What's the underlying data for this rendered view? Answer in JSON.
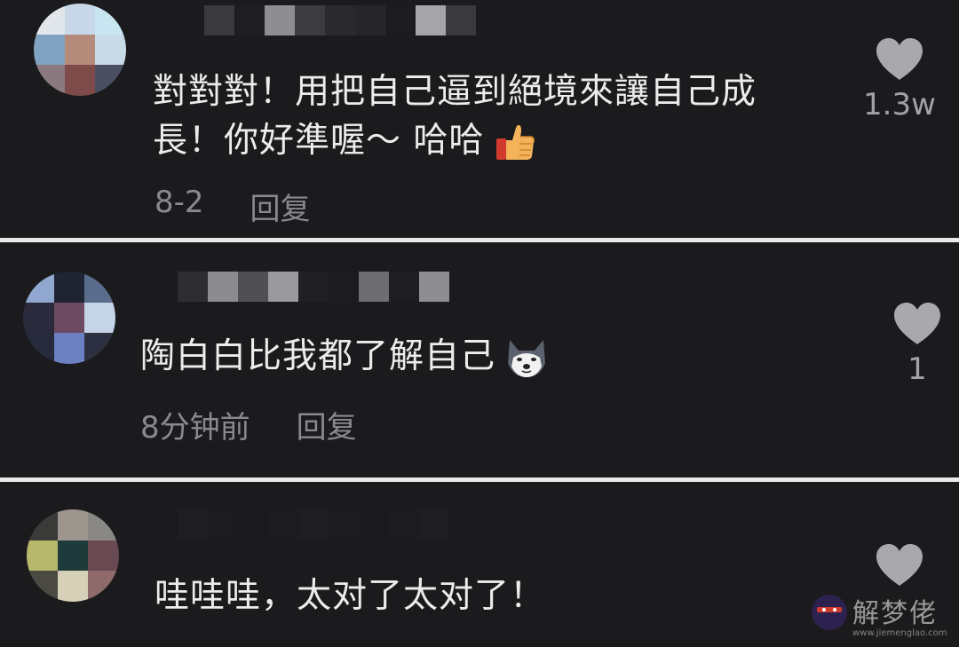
{
  "comments": [
    {
      "text_line1": "對對對！用把自己逼到絕境來讓自己成",
      "text_line2": "長！你好準喔～ 哈哈",
      "emoji": "thumbs-up",
      "time": "8-2",
      "reply": "回复",
      "likes": "1.3w",
      "avatar_colors": [
        "#e1e6ea",
        "#c8d8e8",
        "#c7e6f2",
        "#7fa3c0",
        "#b48a7a",
        "#c9dbe6",
        "#8a7a80",
        "#7e4a4a",
        "#4a4f62"
      ],
      "name_colors": [
        "#3a3a3c",
        "#1e1e20",
        "#8e8e90",
        "#3c3c3e",
        "#2a2a2c",
        "#262628",
        "#1c1c1e",
        "#a5a5a7",
        "#3a3a3c"
      ]
    },
    {
      "text_line1": "陶白白比我都了解自己",
      "emoji": "husky-face",
      "time": "8分钟前",
      "reply": "回复",
      "likes": "1",
      "avatar_colors": [
        "#90a7cf",
        "#1f2433",
        "#5a6c8c",
        "#2a2a3c",
        "#6c4a60",
        "#c6d4e8",
        "#262a3a",
        "#6c80c2",
        "#2c3040"
      ],
      "name_colors": [
        "#2e2e30",
        "#8c8c8e",
        "#505052",
        "#9a9a9c",
        "#202022",
        "#1c1c1e",
        "#6e6e70",
        "#1e1e20",
        "#8e8e90"
      ]
    },
    {
      "text_line1": "哇哇哇，太对了太对了！",
      "likes": "",
      "avatar_colors": [
        "#3a3a38",
        "#9c968e",
        "#8a8884",
        "#b8b86c",
        "#1e3a3a",
        "#6a4a52",
        "#4a4a42",
        "#d6d0b8",
        "#8e6a6a"
      ],
      "name_colors": [
        "#1e1e20",
        "#1c1c1e",
        "#1a1a1c",
        "#1c1c1e",
        "#1e1e20",
        "#1c1c1e",
        "#1a1a1c",
        "#1c1c1e",
        "#1e1e20"
      ]
    }
  ],
  "watermark": {
    "text": "解梦佬",
    "url": "www.jiemenglao.com"
  }
}
